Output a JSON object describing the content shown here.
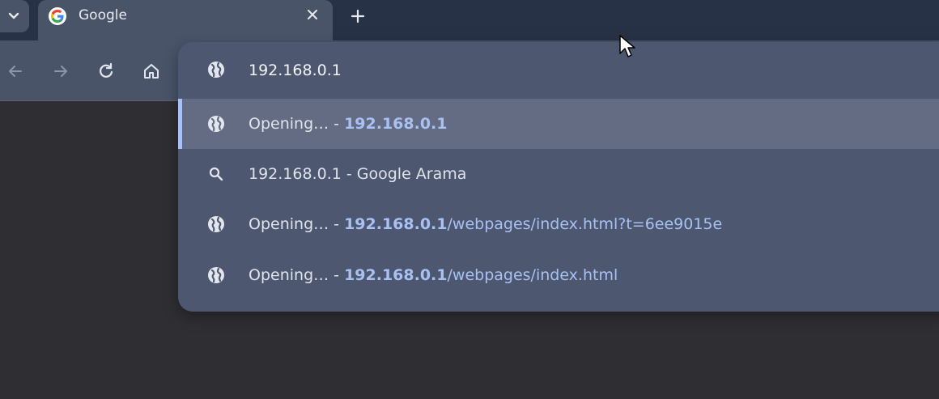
{
  "tab": {
    "title": "Google",
    "close_icon": "close-icon",
    "favicon": "google-logo"
  },
  "omnibox": {
    "value": "192.168.0.1"
  },
  "suggestions": [
    {
      "prefix": "Opening… - ",
      "bold": "192.168.0.1",
      "path": "",
      "icon": "globe-icon",
      "selected": true
    },
    {
      "text": "192.168.0.1 - Google Arama",
      "icon": "search-icon"
    },
    {
      "prefix": "Opening… - ",
      "bold": "192.168.0.1",
      "path": "/webpages/index.html?t=6ee9015e",
      "icon": "globe-icon"
    },
    {
      "prefix": "Opening… - ",
      "bold": "192.168.0.1",
      "path": "/webpages/index.html",
      "icon": "globe-icon"
    }
  ],
  "colors": {
    "tabstrip": "#283246",
    "toolbar": "#4a5469",
    "dropdown": "#4d5770",
    "selected_row": "#636c82",
    "accent": "#a9c1f2",
    "page": "#2f2f33"
  }
}
